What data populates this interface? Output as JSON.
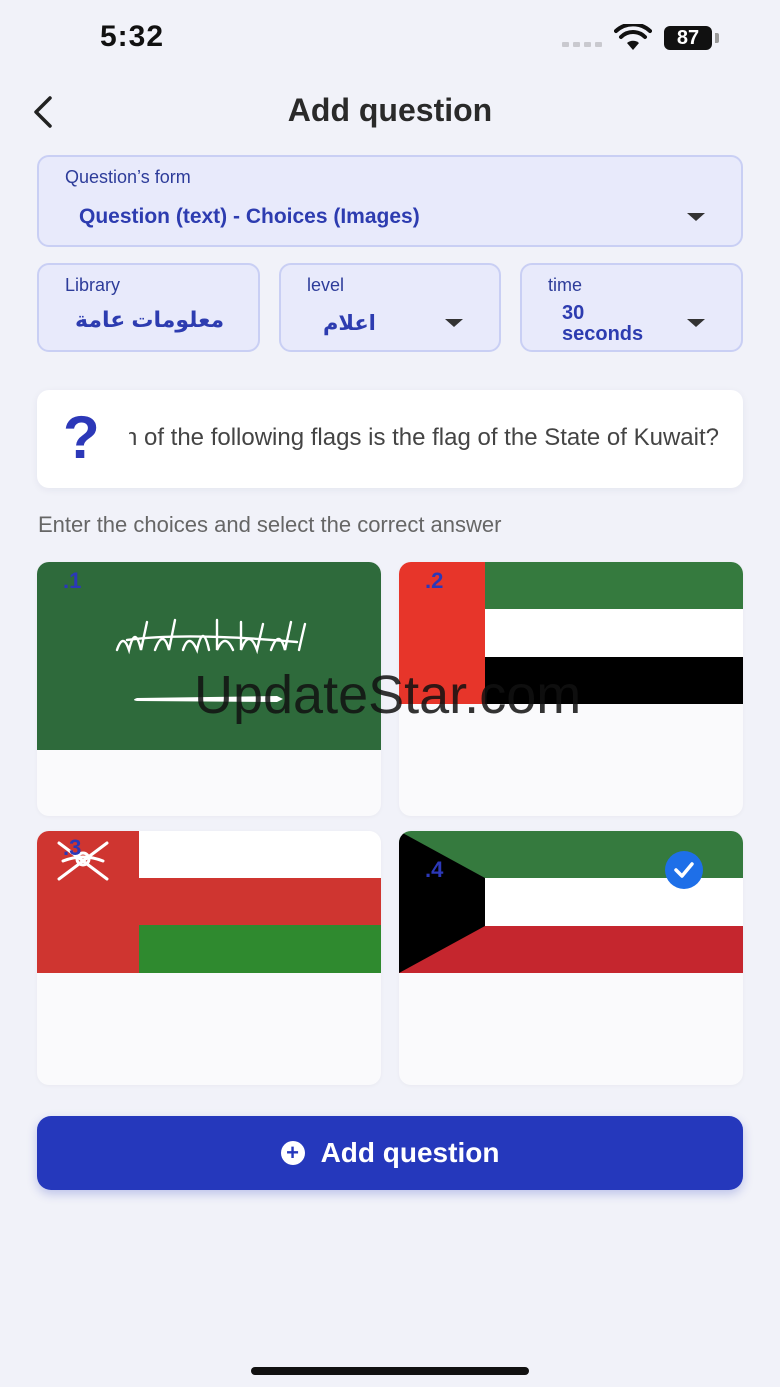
{
  "status_bar": {
    "time": "5:32",
    "battery": "87"
  },
  "header": {
    "title": "Add question"
  },
  "question_form": {
    "label": "Question’s form",
    "value": "Question (text) - Choices (Images)"
  },
  "library": {
    "label": "Library",
    "value": "معلومات عامة"
  },
  "level": {
    "label": "level",
    "value": "اعلام"
  },
  "time": {
    "label": "time",
    "value_line1": "30",
    "value_line2": "seconds"
  },
  "question": {
    "text": "Which of the following flags is the flag of the State of Kuwait?"
  },
  "instructions": "Enter the choices and select the correct answer",
  "choices": [
    {
      "number": ".1",
      "flag": "saudi-arabia",
      "correct": false
    },
    {
      "number": ".2",
      "flag": "uae",
      "correct": false
    },
    {
      "number": ".3",
      "flag": "oman",
      "correct": false
    },
    {
      "number": ".4",
      "flag": "kuwait",
      "correct": true
    }
  ],
  "watermark": "UpdateStar.com",
  "add_button": {
    "label": "Add question",
    "icon": "plus-circle-icon"
  },
  "colors": {
    "accent": "#2538bc",
    "field_bg": "#e8eafb",
    "check": "#1e6fe8"
  }
}
